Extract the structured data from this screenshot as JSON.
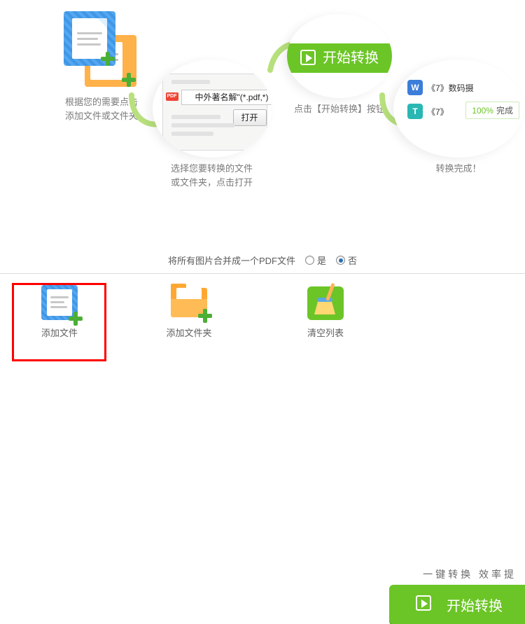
{
  "steps": {
    "s1": {
      "line1": "根据您的需要点击",
      "line2": "添加文件或文件夹"
    },
    "s2": {
      "pdf_badge": "PDF",
      "filename": "中外著名解\"(*.pdf,*)",
      "open_btn": "打开",
      "line1": "选择您要转换的文件",
      "line2": "或文件夹，点击打开"
    },
    "s3": {
      "pill_label": "开始转换",
      "caption": "点击【开始转换】按钮"
    },
    "s4": {
      "row1": {
        "icon": "W",
        "text": "《7》数码摄"
      },
      "row2": {
        "icon": "T",
        "text": "《7》"
      },
      "progress": {
        "pct": "100%",
        "word": "完成"
      },
      "caption": "转换完成！"
    }
  },
  "merge": {
    "label": "将所有图片合并成一个PDF文件",
    "yes": "是",
    "no": "否",
    "selected": "no"
  },
  "actions": {
    "add_file": "添加文件",
    "add_folder": "添加文件夹",
    "clear_list": "清空列表"
  },
  "slogan": "一键转换  效率提",
  "start_button": "开始转换"
}
